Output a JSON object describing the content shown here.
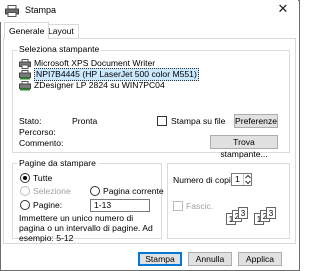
{
  "window": {
    "title": "Stampa",
    "close_glyph": "✕",
    "app_icon": "printer-icon"
  },
  "tabs": [
    {
      "label": "Generale",
      "active": true
    },
    {
      "label": "Layout",
      "active": false
    }
  ],
  "printer_group": {
    "legend": "Seleziona stampante",
    "printers": [
      {
        "name": "Microsoft XPS Document Writer",
        "selected": false,
        "icon": "printer-icon"
      },
      {
        "name": "NPI7B4445 (HP LaserJet 500 color M551)",
        "selected": true,
        "icon": "network-printer-icon"
      },
      {
        "name": "ZDesigner LP 2824 su WIN7PC04",
        "selected": false,
        "icon": "network-printer-icon"
      }
    ],
    "status_label": "Stato:",
    "status_value": "Pronta",
    "location_label": "Percorso:",
    "comment_label": "Commento:",
    "print_to_file_label": "Stampa su file",
    "print_to_file_checked": false,
    "preferences_button": "Preferenze",
    "find_printer_button": "Trova stampante..."
  },
  "page_range_group": {
    "legend": "Pagine da stampare",
    "all_label": "Tutte",
    "selection_label": "Selezione",
    "current_page_label": "Pagina corrente",
    "pages_label": "Pagine:",
    "pages_value": "1-13",
    "selected_option": "all",
    "hint": "Immettere un unico numero di pagina o un intervallo di pagine. Ad esempio: 5-12"
  },
  "copies_group": {
    "copies_label": "Numero di copie:",
    "copies_value": "1",
    "collate_label": "Fascic.",
    "collate_checked": false,
    "collate_pages": [
      "1",
      "2",
      "3"
    ]
  },
  "footer": {
    "print_button": "Stampa",
    "cancel_button": "Annulla",
    "apply_button": "Applica"
  },
  "colors": {
    "selection": "#cce8ff",
    "default_button_border": "#0078d7",
    "button_face": "#e1e1e1"
  }
}
